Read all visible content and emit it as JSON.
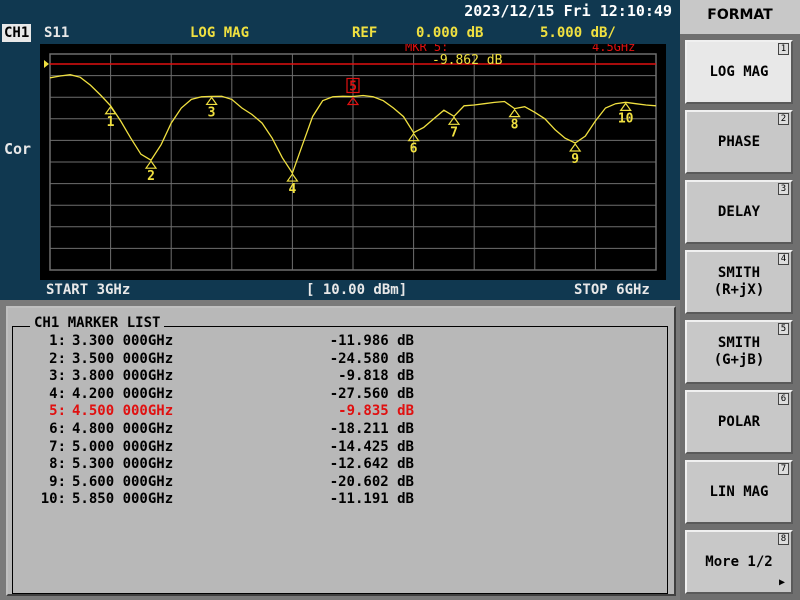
{
  "datetime": "2023/12/15 Fri 12:10:49",
  "header": {
    "channel": "CH1",
    "param": "S11",
    "format": "LOG MAG",
    "ref_label": "REF",
    "ref_value": "0.000 dB",
    "scale": "5.000 dB/"
  },
  "active_marker": {
    "label": "MKR  5:",
    "freq": "4.5GHz",
    "value": "-9.862 dB"
  },
  "side_label": "Cor",
  "footer": {
    "start": "START 3GHz",
    "power": "[ 10.00 dBm]",
    "stop": "STOP 6GHz"
  },
  "marker_list": {
    "title": "CH1 MARKER LIST",
    "markers": [
      {
        "num": "1:",
        "freq": "3.300 000GHz",
        "value": "-11.986 dB",
        "active": false
      },
      {
        "num": "2:",
        "freq": "3.500 000GHz",
        "value": "-24.580 dB",
        "active": false
      },
      {
        "num": "3:",
        "freq": "3.800 000GHz",
        "value": "-9.818 dB",
        "active": false
      },
      {
        "num": "4:",
        "freq": "4.200 000GHz",
        "value": "-27.560 dB",
        "active": false
      },
      {
        "num": "5:",
        "freq": "4.500 000GHz",
        "value": "-9.835 dB",
        "active": true
      },
      {
        "num": "6:",
        "freq": "4.800 000GHz",
        "value": "-18.211 dB",
        "active": false
      },
      {
        "num": "7:",
        "freq": "5.000 000GHz",
        "value": "-14.425 dB",
        "active": false
      },
      {
        "num": "8:",
        "freq": "5.300 000GHz",
        "value": "-12.642 dB",
        "active": false
      },
      {
        "num": "9:",
        "freq": "5.600 000GHz",
        "value": "-20.602 dB",
        "active": false
      },
      {
        "num": "10:",
        "freq": "5.850 000GHz",
        "value": "-11.191 dB",
        "active": false
      }
    ]
  },
  "softkeys": {
    "title": "FORMAT",
    "keys": [
      {
        "label": "LOG MAG",
        "label2": "",
        "num": "1",
        "active": true
      },
      {
        "label": "PHASE",
        "label2": "",
        "num": "2",
        "active": false
      },
      {
        "label": "DELAY",
        "label2": "",
        "num": "3",
        "active": false
      },
      {
        "label": "SMITH",
        "label2": "(R+jX)",
        "num": "4",
        "active": false
      },
      {
        "label": "SMITH",
        "label2": "(G+jB)",
        "num": "5",
        "active": false
      },
      {
        "label": "POLAR",
        "label2": "",
        "num": "6",
        "active": false
      },
      {
        "label": "LIN MAG",
        "label2": "",
        "num": "7",
        "active": false
      },
      {
        "label": "More 1/2",
        "label2": "",
        "num": "8",
        "active": false
      }
    ]
  },
  "colors": {
    "trace": "#f0e040",
    "ref_line": "#e01010",
    "active_marker": "#e01010",
    "header_yellow": "#f0e040",
    "grid": "#6e6e6e"
  },
  "chart_data": {
    "type": "line",
    "x_range_ghz": [
      3,
      6
    ],
    "ref_level_db": 0,
    "scale_db_per_div": 5,
    "ref_position_div": 0,
    "divisions": 10,
    "trace": [
      [
        3.0,
        -5.5
      ],
      [
        3.05,
        -5.1
      ],
      [
        3.1,
        -4.8
      ],
      [
        3.15,
        -5.4
      ],
      [
        3.2,
        -7.2
      ],
      [
        3.25,
        -9.5
      ],
      [
        3.3,
        -11.986
      ],
      [
        3.35,
        -15.5
      ],
      [
        3.4,
        -19.5
      ],
      [
        3.45,
        -23.2
      ],
      [
        3.5,
        -24.58
      ],
      [
        3.55,
        -21.0
      ],
      [
        3.6,
        -16.0
      ],
      [
        3.65,
        -12.5
      ],
      [
        3.7,
        -10.5
      ],
      [
        3.75,
        -9.9
      ],
      [
        3.8,
        -9.818
      ],
      [
        3.85,
        -9.8
      ],
      [
        3.9,
        -10.5
      ],
      [
        3.95,
        -12.5
      ],
      [
        4.0,
        -14.0
      ],
      [
        4.05,
        -16.0
      ],
      [
        4.1,
        -19.5
      ],
      [
        4.15,
        -24.0
      ],
      [
        4.2,
        -27.56
      ],
      [
        4.25,
        -21.0
      ],
      [
        4.3,
        -14.5
      ],
      [
        4.35,
        -10.8
      ],
      [
        4.4,
        -9.9
      ],
      [
        4.45,
        -9.8
      ],
      [
        4.5,
        -9.835
      ],
      [
        4.55,
        -9.6
      ],
      [
        4.6,
        -9.9
      ],
      [
        4.65,
        -10.8
      ],
      [
        4.7,
        -12.5
      ],
      [
        4.75,
        -14.5
      ],
      [
        4.8,
        -18.211
      ],
      [
        4.85,
        -17.0
      ],
      [
        4.9,
        -15.0
      ],
      [
        4.95,
        -13.0
      ],
      [
        5.0,
        -14.425
      ],
      [
        5.05,
        -12.0
      ],
      [
        5.1,
        -11.8
      ],
      [
        5.15,
        -11.5
      ],
      [
        5.2,
        -11.2
      ],
      [
        5.25,
        -11.0
      ],
      [
        5.3,
        -12.642
      ],
      [
        5.35,
        -12.2
      ],
      [
        5.4,
        -13.5
      ],
      [
        5.45,
        -15.0
      ],
      [
        5.5,
        -17.5
      ],
      [
        5.55,
        -19.5
      ],
      [
        5.6,
        -20.602
      ],
      [
        5.65,
        -19.0
      ],
      [
        5.7,
        -15.5
      ],
      [
        5.75,
        -12.5
      ],
      [
        5.8,
        -11.5
      ],
      [
        5.85,
        -11.191
      ],
      [
        5.9,
        -11.5
      ],
      [
        5.95,
        -11.8
      ],
      [
        6.0,
        -12.0
      ]
    ],
    "markers": [
      {
        "id": "1",
        "x": 3.3,
        "y": -11.986
      },
      {
        "id": "2",
        "x": 3.5,
        "y": -24.58
      },
      {
        "id": "3",
        "x": 3.8,
        "y": -9.818
      },
      {
        "id": "4",
        "x": 4.2,
        "y": -27.56
      },
      {
        "id": "5",
        "x": 4.5,
        "y": -9.835,
        "active": true
      },
      {
        "id": "6",
        "x": 4.8,
        "y": -18.211
      },
      {
        "id": "7",
        "x": 5.0,
        "y": -14.425
      },
      {
        "id": "8",
        "x": 5.3,
        "y": -12.642
      },
      {
        "id": "9",
        "x": 5.6,
        "y": -20.602
      },
      {
        "id": "10",
        "x": 5.85,
        "y": -11.191
      }
    ]
  }
}
